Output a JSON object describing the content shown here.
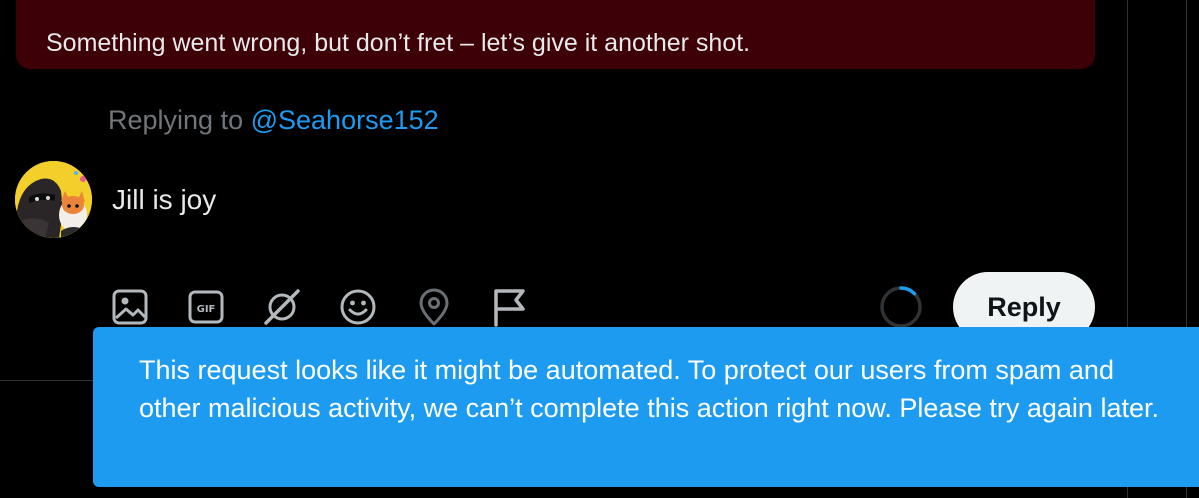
{
  "error_banner": {
    "message": "Something went wrong, but don’t fret – let’s give it another shot."
  },
  "reply_context": {
    "prefix": "Replying to",
    "handle": "@Seahorse152"
  },
  "composer": {
    "text": "Jill is joy",
    "toolbar": [
      {
        "name": "media-icon"
      },
      {
        "name": "gif-icon",
        "label": "GIF"
      },
      {
        "name": "grok-icon"
      },
      {
        "name": "emoji-icon"
      },
      {
        "name": "location-icon"
      },
      {
        "name": "flag-icon"
      }
    ],
    "character_progress_icon": "progress-ring-icon",
    "reply_label": "Reply"
  },
  "toast": {
    "message": "This request looks like it might be automated. To protect our users from spam and other malicious activity, we can’t complete this action right now. Please try again later."
  },
  "colors": {
    "background": "#000000",
    "error_banner_bg": "#3d0007",
    "accent_blue": "#1d9bf0",
    "muted_text": "#71767b",
    "primary_text": "#e7e9ea",
    "reply_button_bg": "#eff3f4"
  }
}
